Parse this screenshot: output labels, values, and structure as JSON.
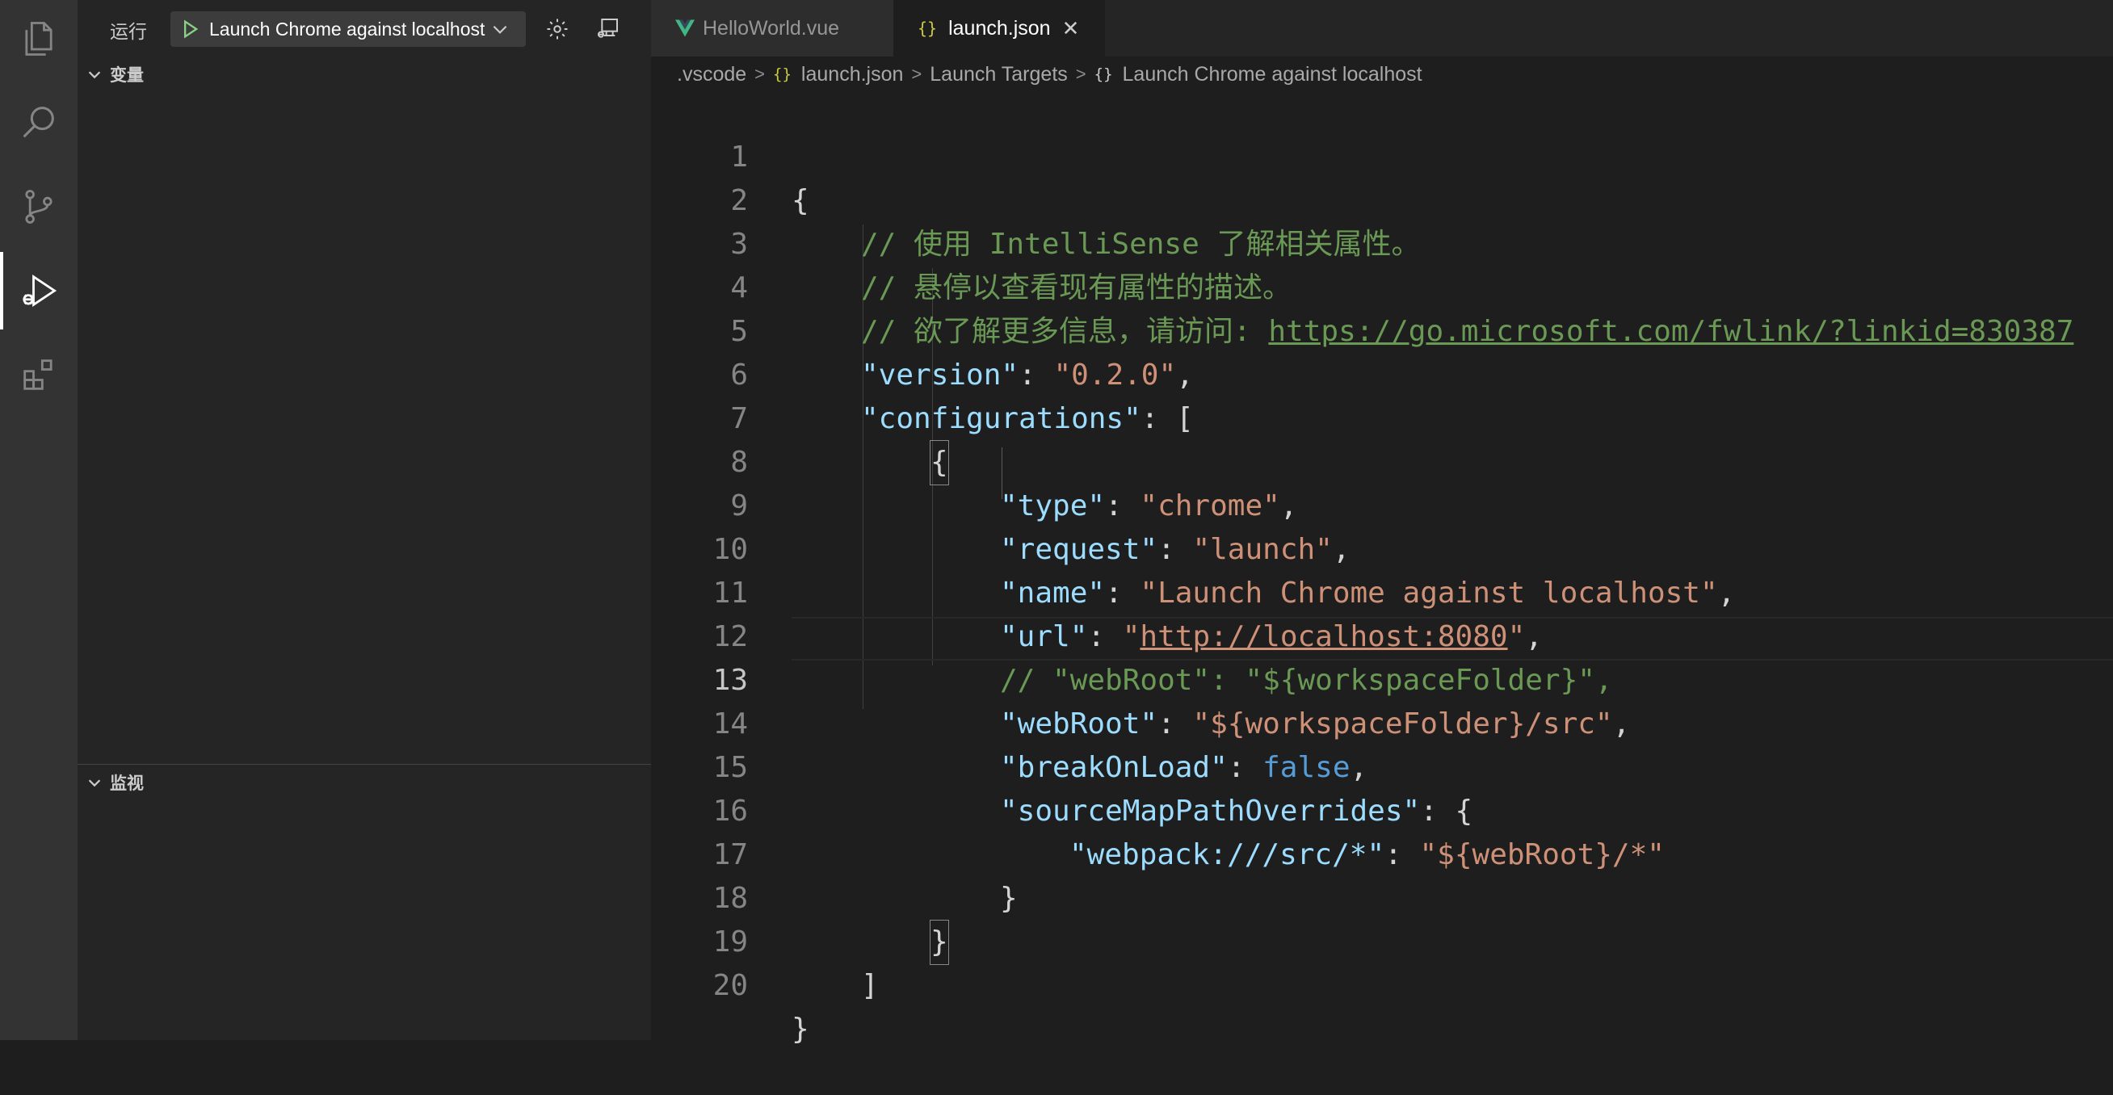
{
  "activity_bar": {
    "items": [
      {
        "name": "explorer",
        "icon": "files-icon"
      },
      {
        "name": "search",
        "icon": "search-icon"
      },
      {
        "name": "source-control",
        "icon": "source-control-icon"
      },
      {
        "name": "run-and-debug",
        "icon": "run-debug-icon",
        "active": true
      },
      {
        "name": "extensions",
        "icon": "extensions-icon"
      }
    ]
  },
  "sidebar": {
    "run_label": "运行",
    "config_name": "Launch Chrome against localhost",
    "sections": {
      "variables": "变量",
      "watch": "监视"
    }
  },
  "tabs": [
    {
      "label": "HelloWorld.vue",
      "icon": "vue-icon",
      "active": false
    },
    {
      "label": "launch.json",
      "icon": "json-icon",
      "active": true
    }
  ],
  "breadcrumb": {
    "folder": ".vscode",
    "file": "launch.json",
    "section": "Launch Targets",
    "item": "Launch Chrome against localhost"
  },
  "code": {
    "current_line": 13,
    "lines": [
      {
        "n": "1",
        "t": "{"
      },
      {
        "n": "2",
        "t": "// 使用 IntelliSense 了解相关属性。"
      },
      {
        "n": "3",
        "t": "// 悬停以查看现有属性的描述。"
      },
      {
        "n": "4",
        "t": "// 欲了解更多信息，请访问: ",
        "link": "https://go.microsoft.com/fwlink/?linkid=830387"
      },
      {
        "n": "5",
        "key": "\"version\"",
        "sep": ": ",
        "val": "\"0.2.0\"",
        "end": ","
      },
      {
        "n": "6",
        "key": "\"configurations\"",
        "sep": ": ",
        "end": "["
      },
      {
        "n": "7",
        "t": "{"
      },
      {
        "n": "8",
        "key": "\"type\"",
        "sep": ": ",
        "val": "\"chrome\"",
        "end": ","
      },
      {
        "n": "9",
        "key": "\"request\"",
        "sep": ": ",
        "val": "\"launch\"",
        "end": ","
      },
      {
        "n": "10",
        "key": "\"name\"",
        "sep": ": ",
        "val": "\"Launch Chrome against localhost\"",
        "end": ","
      },
      {
        "n": "11",
        "key": "\"url\"",
        "sep": ": ",
        "val_open": "\"",
        "val_link": "http://localhost:8080",
        "val_close": "\"",
        "end": ","
      },
      {
        "n": "12",
        "t": "// \"webRoot\": \"${workspaceFolder}\","
      },
      {
        "n": "13",
        "key": "\"webRoot\"",
        "sep": ": ",
        "val": "\"${workspaceFolder}/src\"",
        "end": ","
      },
      {
        "n": "14",
        "key": "\"breakOnLoad\"",
        "sep": ": ",
        "bool": "false",
        "end": ","
      },
      {
        "n": "15",
        "key": "\"sourceMapPathOverrides\"",
        "sep": ": ",
        "end": "{"
      },
      {
        "n": "16",
        "key": "\"webpack:///src/*\"",
        "sep": ": ",
        "val": "\"${webRoot}/*\"",
        "end": ""
      },
      {
        "n": "17",
        "t": "}"
      },
      {
        "n": "18",
        "t": "}"
      },
      {
        "n": "19",
        "t": "]"
      },
      {
        "n": "20",
        "t": "}"
      }
    ]
  }
}
